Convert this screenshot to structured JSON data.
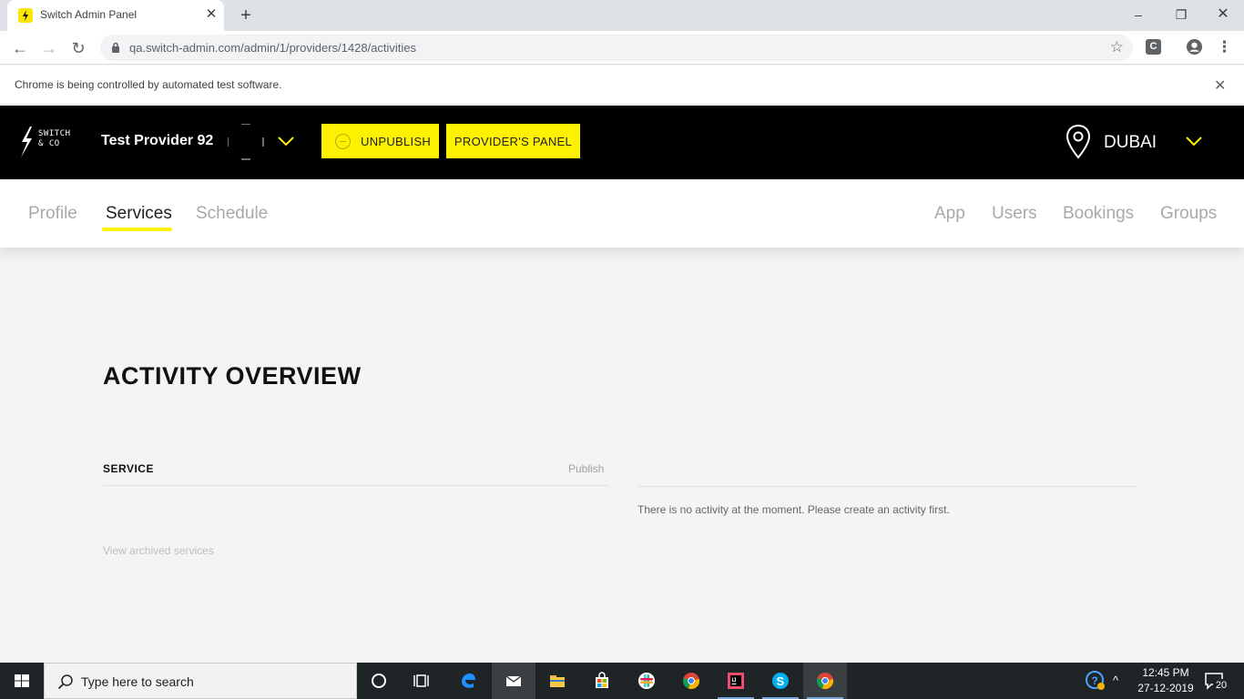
{
  "browser": {
    "tab_title": "Switch Admin Panel",
    "url": "qa.switch-admin.com/admin/1/providers/1428/activities",
    "infobar_text": "Chrome is being controlled by automated test software.",
    "extension_label": "C"
  },
  "header": {
    "logo_line1": "SWITCH",
    "logo_line2": "& CO",
    "provider_name": "Test Provider 92",
    "unpublish_label": "UNPUBLISH",
    "providers_panel_label": "PROVIDER'S PANEL",
    "city": "DUBAI",
    "accent_color": "#fff200"
  },
  "subnav": {
    "left": [
      "Profile",
      "Services",
      "Schedule"
    ],
    "right": [
      "App",
      "Users",
      "Bookings",
      "Groups"
    ],
    "active": "Services"
  },
  "main": {
    "title": "ACTIVITY OVERVIEW",
    "service_header": "SERVICE",
    "publish_header": "Publish",
    "empty_message": "There is no activity at the moment. Please create an activity first.",
    "archived_link": "View archived services"
  },
  "taskbar": {
    "search_placeholder": "Type here to search",
    "time": "12:45 PM",
    "date": "27-12-2019",
    "notification_count": "20",
    "pinned": [
      "cortana-icon",
      "task-view-icon",
      "edge-icon",
      "mail-icon",
      "file-explorer-icon",
      "store-icon",
      "slack-icon",
      "chrome-icon",
      "intellij-icon",
      "skype-icon",
      "chrome-icon"
    ]
  }
}
